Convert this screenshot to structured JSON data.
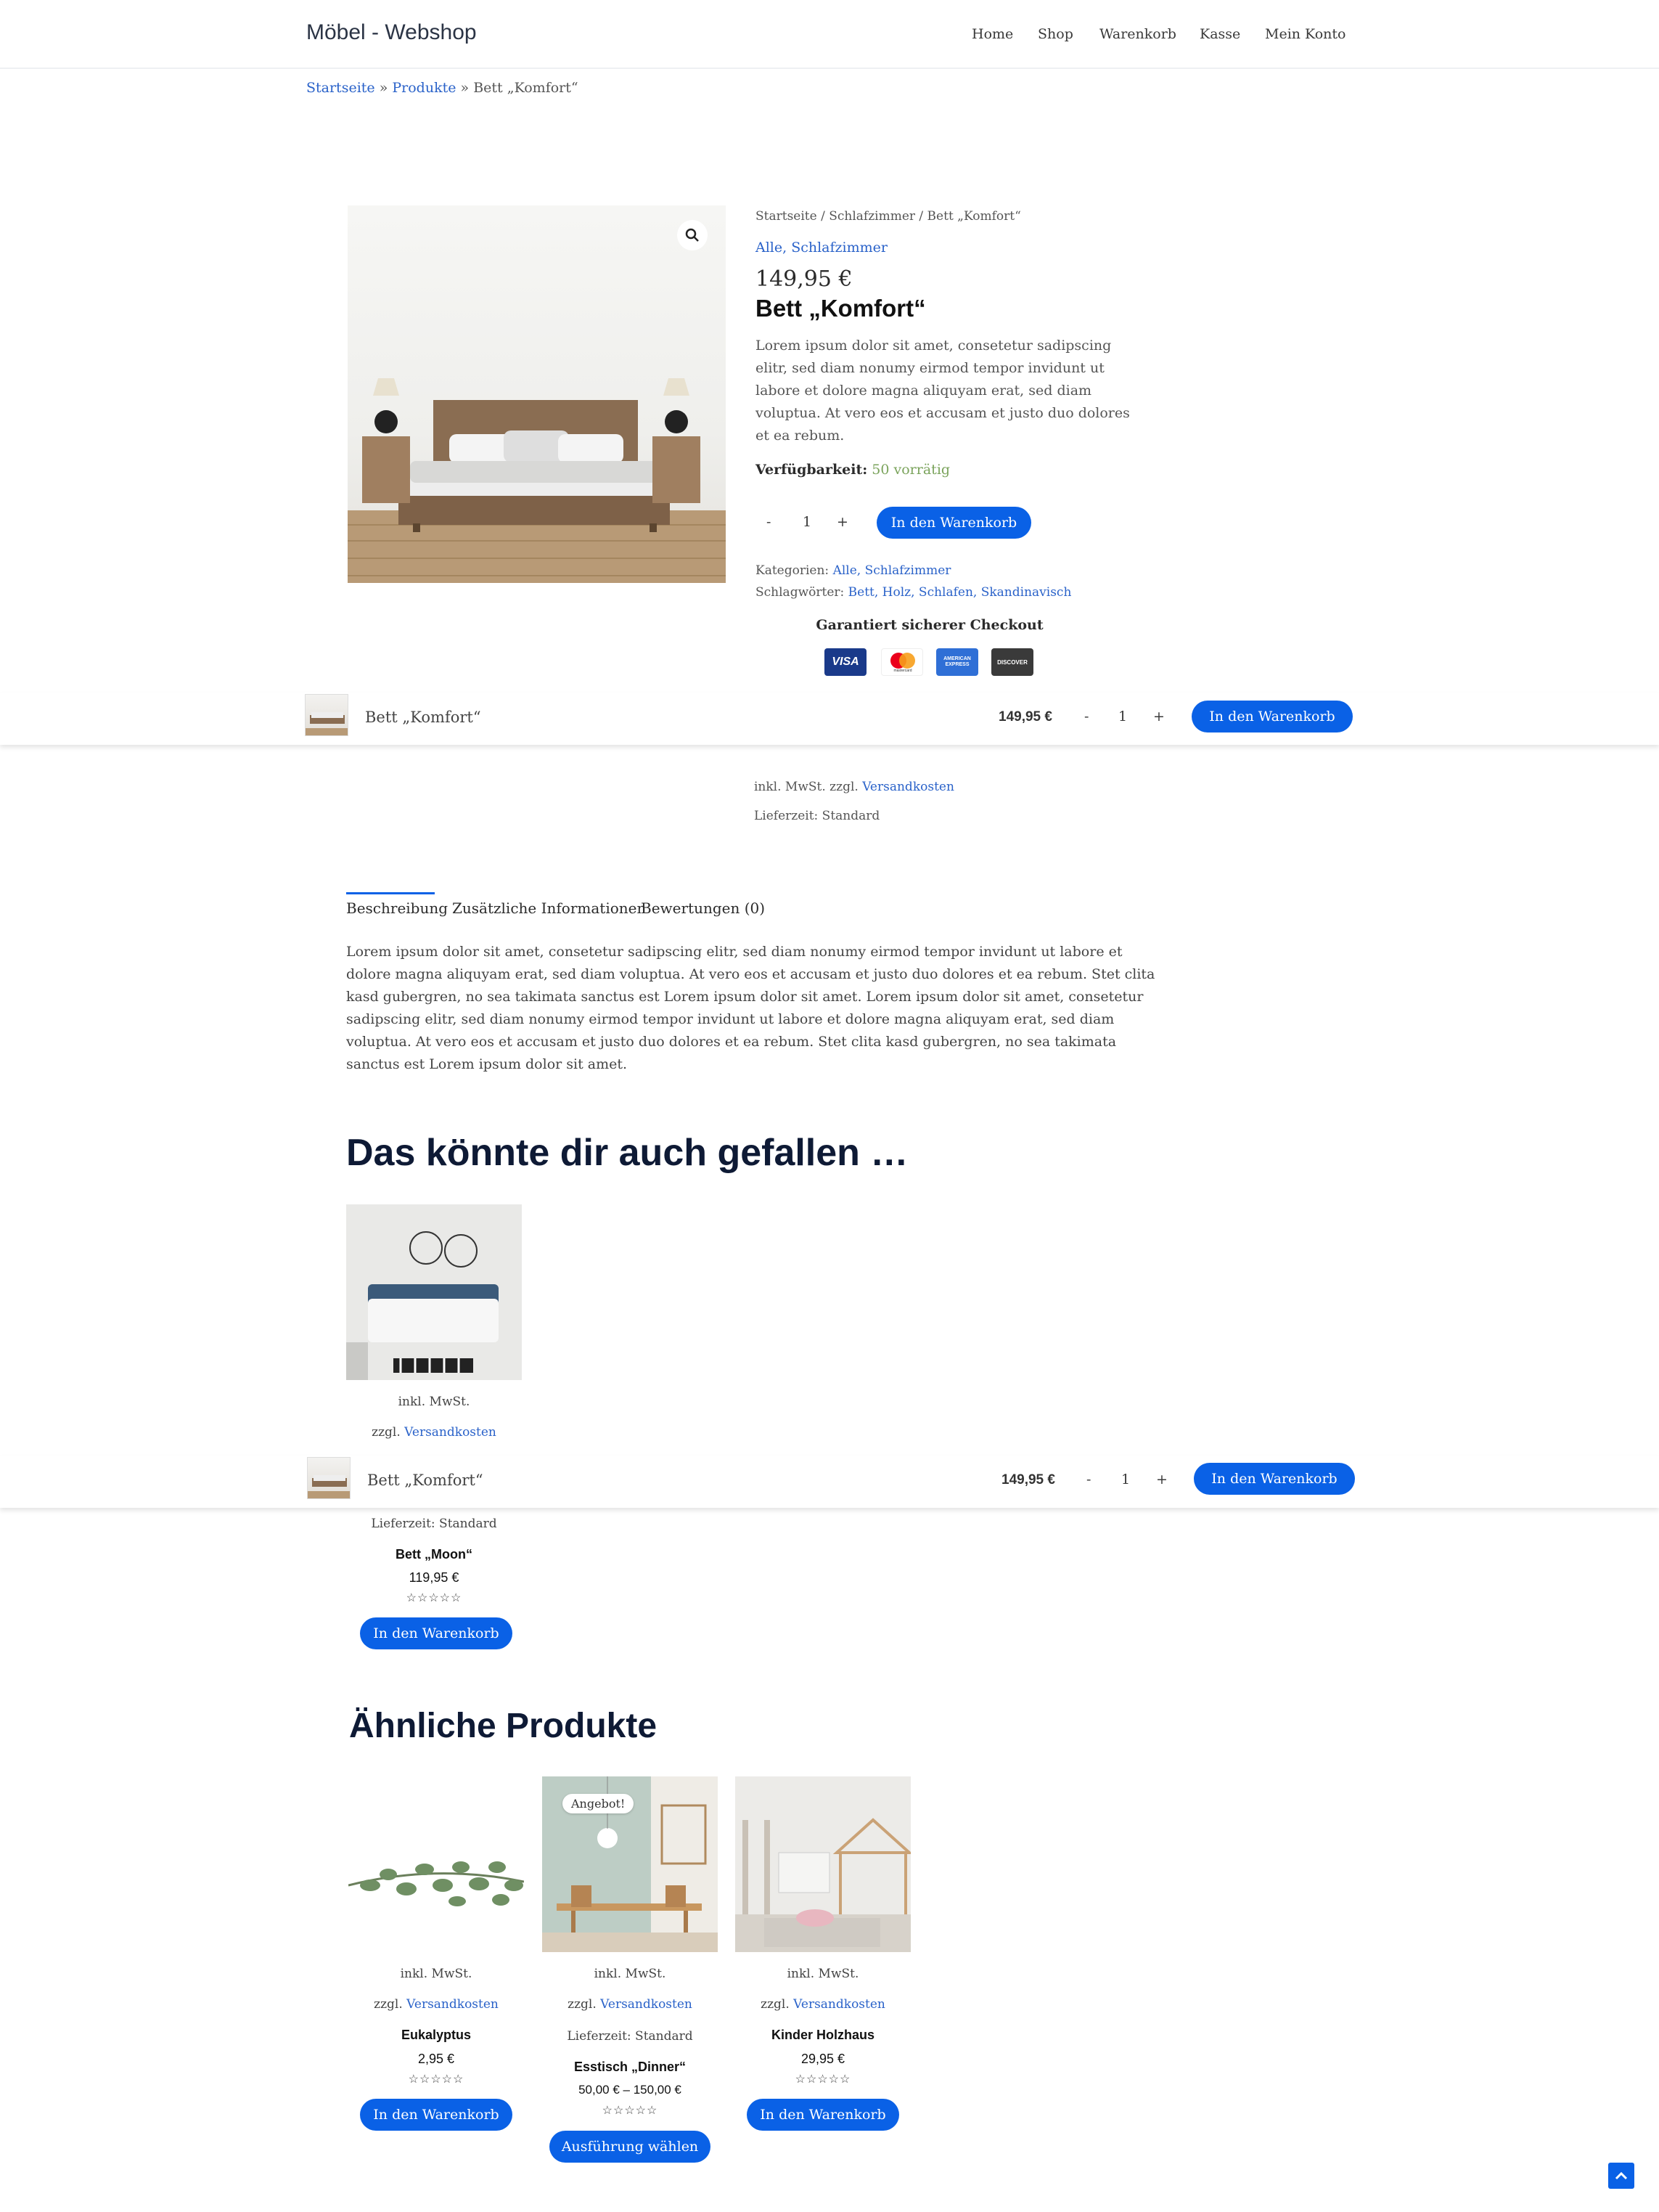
{
  "header": {
    "logo": "Möbel - Webshop",
    "nav": [
      "Home",
      "Shop",
      "Warenkorb",
      "Kasse",
      "Mein Konto"
    ]
  },
  "breadcrumb": {
    "home": "Startseite",
    "sep": "»",
    "products": "Produkte",
    "current": "Bett „Komfort“"
  },
  "product": {
    "path": "Startseite / Schlafzimmer / Bett „Komfort“",
    "categories_link": "Alle, Schlafzimmer",
    "price": "149,95 €",
    "title": "Bett „Komfort“",
    "desc_lines": [
      "Lorem ipsum dolor sit amet, consetetur sadipscing",
      "elitr, sed diam nonumy eirmod tempor invidunt ut",
      "labore et dolore magna aliquyam erat, sed diam",
      "voluptua. At vero eos et accusam et justo duo dolores",
      "et ea rebum."
    ],
    "availability_label": "Verfügbarkeit:",
    "availability_value": "50 vorrätig",
    "qty_minus": "-",
    "qty_value": "1",
    "qty_plus": "+",
    "add_to_cart": "In den Warenkorb",
    "categories_label": "Kategorien:",
    "categories_value": "Alle, Schlafzimmer",
    "tags_label": "Schlagwörter:",
    "tags_value": "Bett, Holz, Schlafen, Skandinavisch",
    "secure_checkout": "Garantiert sicherer Checkout",
    "payment_icons": [
      "VISA",
      "mastercard",
      "AMERICAN EXPRESS",
      "DISCOVER"
    ],
    "tax_prefix": "inkl. MwSt. zzgl.",
    "shipping_link": "Versandkosten",
    "delivery": "Lieferzeit: Standard"
  },
  "sticky": {
    "name": "Bett „Komfort“",
    "price": "149,95 €",
    "qty_minus": "-",
    "qty_value": "1",
    "qty_plus": "+",
    "button": "In den Warenkorb"
  },
  "tabs": {
    "items": [
      "Beschreibung",
      "Zusätzliche Informationen",
      "Bewertungen (0)"
    ],
    "description_lines": [
      "Lorem ipsum dolor sit amet, consetetur sadipscing elitr, sed diam nonumy eirmod tempor invidunt ut labore et",
      "dolore magna aliquyam erat, sed diam voluptua. At vero eos et accusam et justo duo dolores et ea rebum. Stet clita",
      "kasd gubergren, no sea takimata sanctus est Lorem ipsum dolor sit amet. Lorem ipsum dolor sit amet, consetetur",
      "sadipscing elitr, sed diam nonumy eirmod tempor invidunt ut labore et dolore magna aliquyam erat, sed diam",
      "voluptua. At vero eos et accusam et justo duo dolores et ea rebum. Stet clita kasd gubergren, no sea takimata",
      "sanctus est Lorem ipsum dolor sit amet."
    ]
  },
  "upsell": {
    "heading": "Das könnte dir auch gefallen …",
    "item": {
      "tax": "inkl. MwSt.",
      "shipping_prefix": "zzgl.",
      "shipping_link": "Versandkosten",
      "delivery": "Lieferzeit: Standard",
      "name": "Bett „Moon“",
      "price": "119,95 €",
      "rating": "☆☆☆☆☆",
      "button": "In den Warenkorb"
    }
  },
  "related": {
    "heading": "Ähnliche Produkte",
    "items": [
      {
        "badge": "",
        "tax": "inkl. MwSt.",
        "shipping_prefix": "zzgl.",
        "shipping_link": "Versandkosten",
        "delivery": "",
        "name": "Eukalyptus",
        "price": "2,95 €",
        "rating": "☆☆☆☆☆",
        "button": "In den Warenkorb"
      },
      {
        "badge": "Angebot!",
        "tax": "inkl. MwSt.",
        "shipping_prefix": "zzgl.",
        "shipping_link": "Versandkosten",
        "delivery": "Lieferzeit: Standard",
        "name": "Esstisch „Dinner“",
        "price": "50,00 € – 150,00 €",
        "rating": "☆☆☆☆☆",
        "button": "Ausführung wählen"
      },
      {
        "badge": "",
        "tax": "inkl. MwSt.",
        "shipping_prefix": "zzgl.",
        "shipping_link": "Versandkosten",
        "delivery": "",
        "name": "Kinder Holzhaus",
        "price": "29,95 €",
        "rating": "☆☆☆☆☆",
        "button": "In den Warenkorb"
      }
    ]
  },
  "scroll_top_icon": "chevron-up-icon",
  "colors": {
    "accent": "#0a61e6",
    "link": "#2a62c9",
    "heading": "#0e1a35",
    "in_stock": "#7aa35b"
  }
}
